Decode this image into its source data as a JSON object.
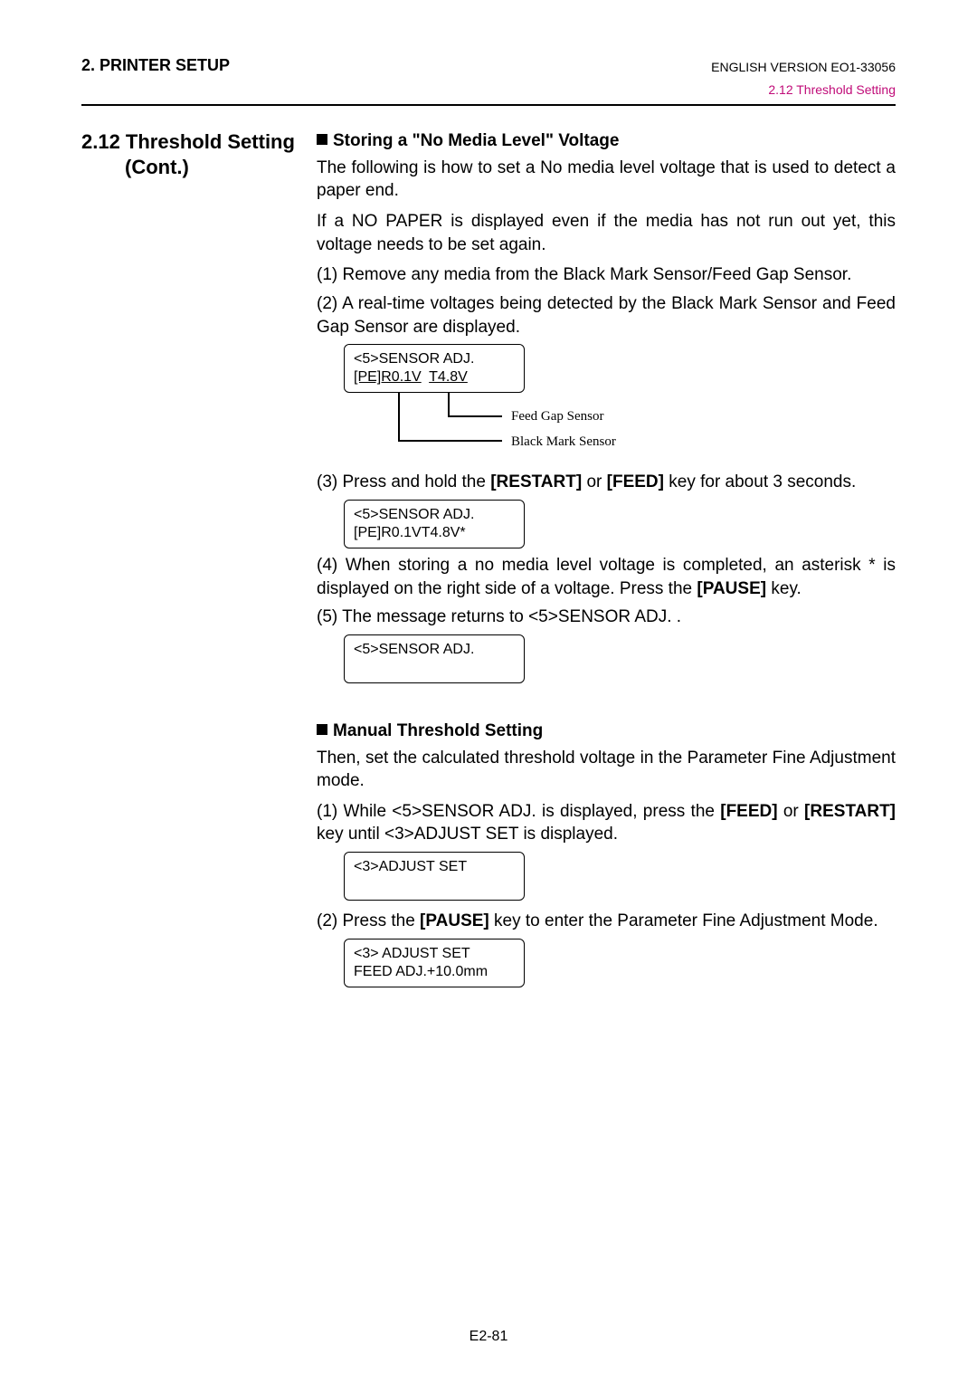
{
  "header": {
    "left": "2. PRINTER SETUP",
    "right": "ENGLISH VERSION EO1-33056",
    "sub": "2.12 Threshold Setting"
  },
  "left_title_line1": "2.12 Threshold Setting",
  "left_title_line2": "(Cont.)",
  "sec1": {
    "heading": "Storing a \"No Media Level\" Voltage",
    "p1": "The following is how to set a  No media level  voltage that is used to detect a paper end.",
    "p2": "If a  NO PAPER  is displayed even if the media has not run out yet, this voltage needs to be set again.",
    "step1": "(1) Remove any media from the Black Mark Sensor/Feed Gap Sensor.",
    "step2": "(2) A real-time voltages being detected by the Black Mark Sensor and Feed Gap Sensor are displayed.",
    "lcd1_line1": "<5>SENSOR ADJ.",
    "lcd1_val1": "[PE]R0.1V",
    "lcd1_val2": "T4.8V",
    "lbl_feed": "Feed Gap Sensor",
    "lbl_black": "Black Mark Sensor",
    "step3_a": "(3) Press and hold the ",
    "step3_k1": "[RESTART]",
    "step3_b": " or ",
    "step3_k2": "[FEED]",
    "step3_c": " key for about 3 seconds.",
    "lcd2_line1": "<5>SENSOR ADJ.",
    "lcd2_line2": "[PE]R0.1VT4.8V*",
    "step4_a": "(4) When storing a  no media level  voltage is completed, an asterisk  *  is displayed on the right side of a voltage.  Press the ",
    "step4_k": "[PAUSE]",
    "step4_b": " key.",
    "step5": "(5) The message returns to  <5>SENSOR ADJ. .",
    "lcd3_line1": "<5>SENSOR ADJ."
  },
  "sec2": {
    "heading": "Manual Threshold Setting",
    "p1": "Then, set the calculated threshold voltage in the Parameter Fine Adjustment mode.",
    "step1_a": "(1) While  <5>SENSOR ADJ.  is displayed, press the ",
    "step1_k1": "[FEED]",
    "step1_b": " or ",
    "step1_k2": "[RESTART]",
    "step1_c": " key until  <3>ADJUST SET  is displayed.",
    "lcd4_line1": "<3>ADJUST SET",
    "step2_a": "(2) Press the ",
    "step2_k": "[PAUSE]",
    "step2_b": " key to enter the Parameter Fine Adjustment Mode.",
    "lcd5_line1": "<3> ADJUST SET",
    "lcd5_line2": "FEED ADJ.+10.0mm"
  },
  "footer": "E2-81"
}
